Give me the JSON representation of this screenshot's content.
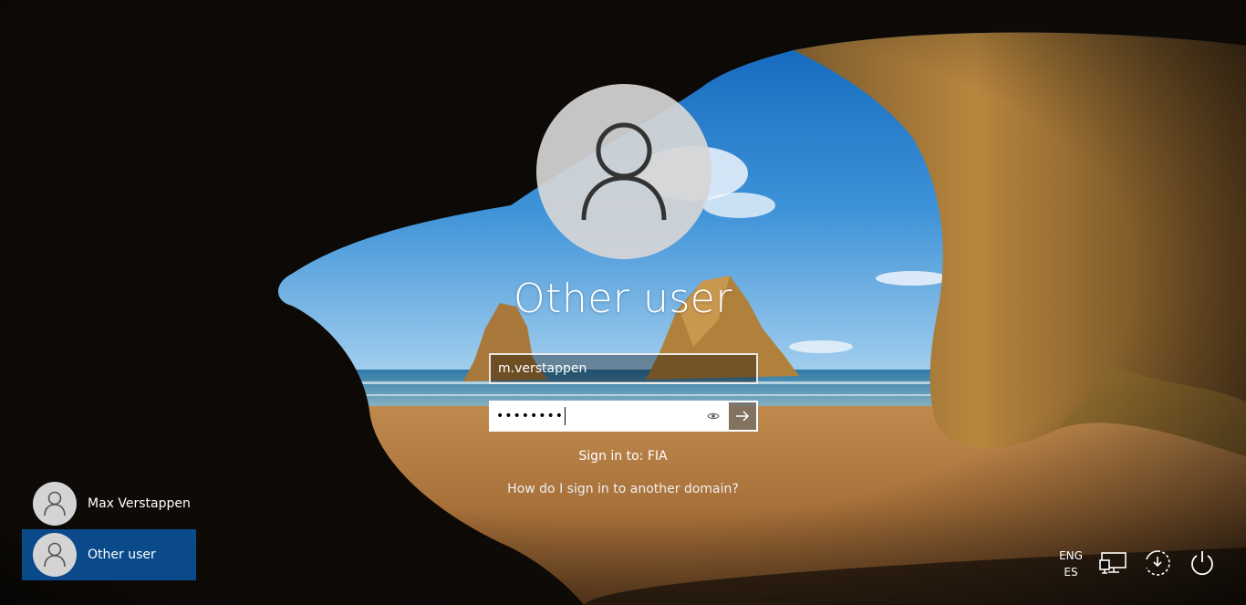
{
  "login": {
    "display_user": "Other user",
    "username_value": "m.verstappen",
    "password_masked": "••••••••",
    "sign_in_to": "Sign in to: FIA",
    "domain_help_link": "How do I sign in to another domain?"
  },
  "user_list": [
    {
      "name": "Max Verstappen",
      "selected": false
    },
    {
      "name": "Other user",
      "selected": true
    }
  ],
  "tray": {
    "language_line1": "ENG",
    "language_line2": "ES",
    "icons": [
      "network-icon",
      "ease-of-access-icon",
      "power-icon"
    ]
  },
  "colors": {
    "selected_user_bg": "#0a4a8a",
    "avatar_bg": "#d6d6d6"
  }
}
